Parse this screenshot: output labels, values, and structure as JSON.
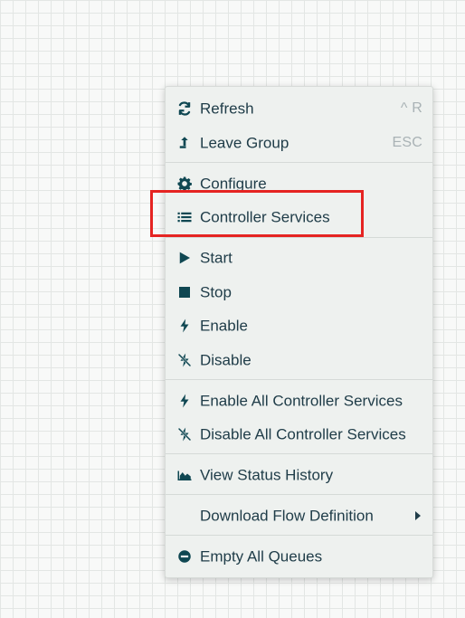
{
  "canvas": {
    "background_color": "#f8f9f8",
    "grid_color": "#e3e6e4"
  },
  "context_menu": {
    "items": [
      {
        "label": "Refresh",
        "shortcut": "^ R",
        "icon": "refresh-icon"
      },
      {
        "label": "Leave Group",
        "shortcut": "ESC",
        "icon": "leave-group-icon"
      },
      {
        "label": "Configure",
        "icon": "gear-icon"
      },
      {
        "label": "Controller Services",
        "icon": "list-icon"
      },
      {
        "label": "Start",
        "icon": "play-icon"
      },
      {
        "label": "Stop",
        "icon": "stop-icon"
      },
      {
        "label": "Enable",
        "icon": "lightning-icon"
      },
      {
        "label": "Disable",
        "icon": "disabled-lightning-icon"
      },
      {
        "label": "Enable All Controller Services",
        "icon": "lightning-icon"
      },
      {
        "label": "Disable All Controller Services",
        "icon": "disabled-lightning-icon"
      },
      {
        "label": "View Status History",
        "icon": "area-chart-icon"
      },
      {
        "label": "Download Flow Definition",
        "icon": "chevron-right-icon"
      },
      {
        "label": "Empty All Queues",
        "icon": "minus-circle-icon"
      }
    ]
  },
  "highlight": {
    "target": "Controller Services",
    "color": "#e52422"
  }
}
